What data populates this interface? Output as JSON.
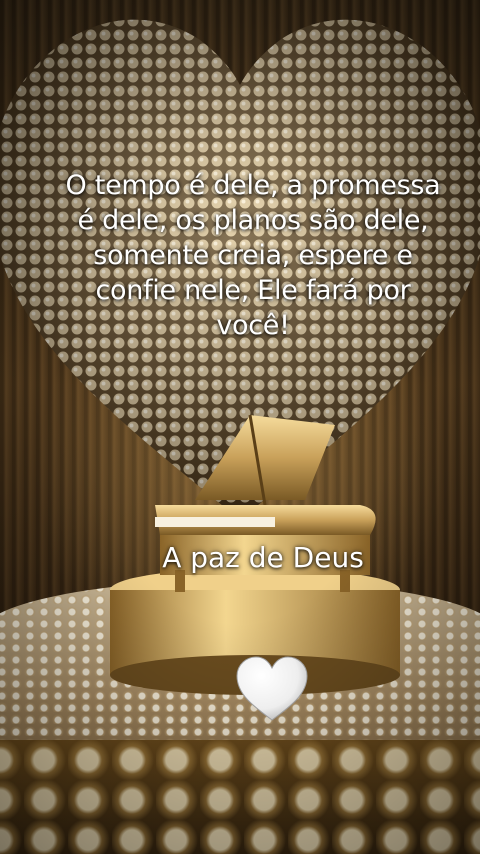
{
  "image": {
    "description_icons": [
      "pearl-heart",
      "golden-piano",
      "white-heart-icon"
    ],
    "colors": {
      "text": "#ffffff",
      "gold": "#c9a15a",
      "pearl": "#f2e6cf",
      "background_dark": "#2a1d0e"
    }
  },
  "quote": {
    "text": "O tempo é dele, a promessa\né dele, os planos são dele,\nsomente creia, espere e\nconfie nele, Ele fará por\nvocê!"
  },
  "signature": {
    "text": "A paz de Deus"
  },
  "emoji": {
    "icon": "white-heart-icon"
  }
}
